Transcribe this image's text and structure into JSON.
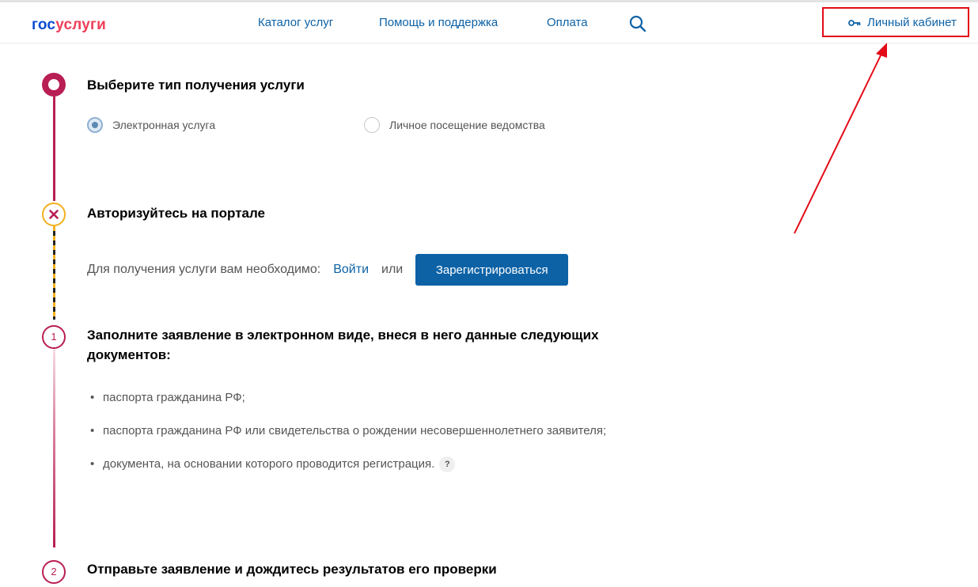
{
  "header": {
    "logo_part1": "гос",
    "logo_part2": "услуги",
    "nav": [
      "Каталог услуг",
      "Помощь и поддержка",
      "Оплата"
    ],
    "search_icon": "search-icon",
    "cabinet_label": "Личный кабинет",
    "cabinet_icon": "key-icon"
  },
  "steps": {
    "step1": {
      "title": "Выберите тип получения услуги",
      "options": [
        "Электронная услуга",
        "Личное посещение ведомства"
      ],
      "selected": "Электронная услуга"
    },
    "step2": {
      "title": "Авторизуйтесь на портале",
      "prompt": "Для получения услуги вам необходимо:",
      "login_label": "Войти",
      "or_label": "или",
      "register_label": "Зарегистрироваться"
    },
    "step3": {
      "number": "1",
      "title": "Заполните заявление в электронном виде, внеся в него данные следующих документов:",
      "documents": [
        "паспорта гражданина РФ;",
        "паспорта гражданина РФ или свидетельства о рождении несовершеннолетнего заявителя;",
        "документа, на основании которого проводится регистрация."
      ],
      "help": "?"
    },
    "step4": {
      "number": "2",
      "title": "Отправьте заявление и дождитесь результатов его проверки"
    }
  },
  "colors": {
    "brand_blue": "#0d62a6",
    "accent_crimson": "#b81e54",
    "warning_yellow": "#f2b01e",
    "annotation_red": "#e30b17"
  }
}
